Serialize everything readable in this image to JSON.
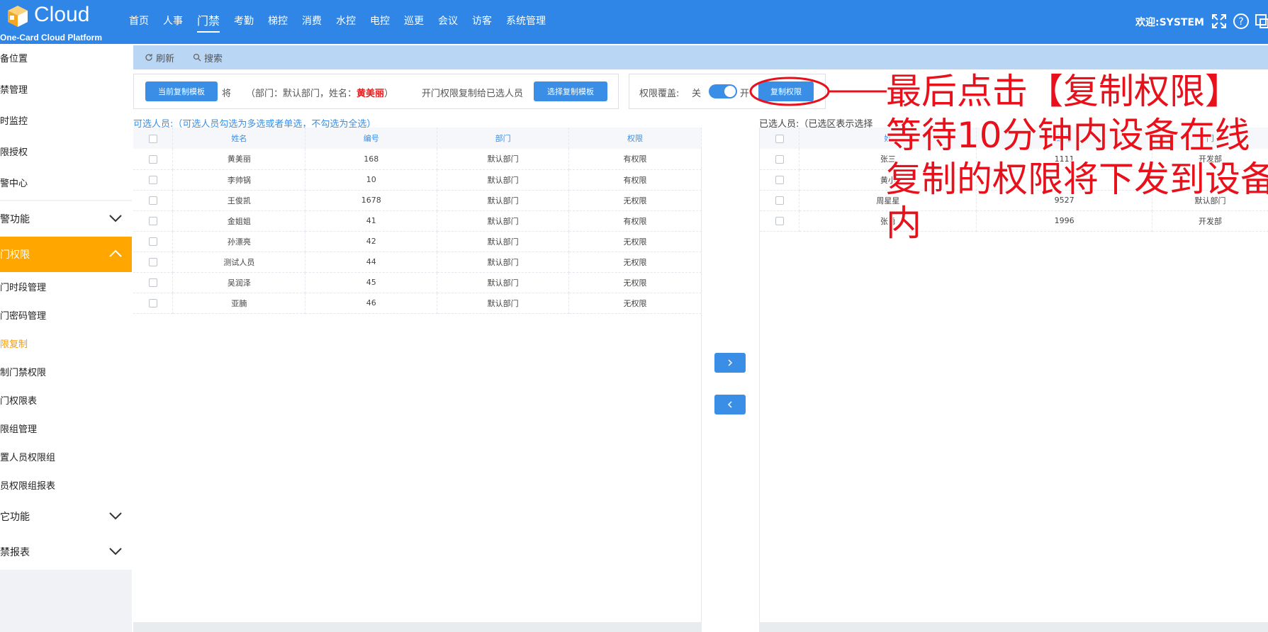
{
  "app": {
    "logo_text": "Cloud",
    "logo_sub": "One-Card Cloud Platform",
    "welcome": "欢迎:SYSTEM"
  },
  "nav": [
    "首页",
    "人事",
    "门禁",
    "考勤",
    "梯控",
    "消费",
    "水控",
    "电控",
    "巡更",
    "会议",
    "访客",
    "系统管理"
  ],
  "sidebar": {
    "top_items": [
      "备位置",
      "禁管理",
      "时监控",
      "限授权",
      "警中心"
    ],
    "group1": "警功能",
    "group_open": "门权限",
    "sub_items": [
      "门时段管理",
      "门密码管理",
      "限复制",
      "制门禁权限",
      "门权限表",
      "限组管理",
      "置人员权限组",
      "员权限组报表"
    ],
    "group3": "它功能",
    "group4": "禁报表"
  },
  "toolbar": {
    "refresh": "刷新",
    "search": "搜索"
  },
  "copy_cfg": {
    "current_tpl_btn": "当前复制模板",
    "will": "将",
    "desc_prefix": "（部门：默认部门，姓名：",
    "name": "黄美丽",
    "desc_suffix": "）",
    "copy_to": "开门权限复制给已选人员",
    "choose_tpl_btn": "选择复制模板",
    "overwrite_label": "权限覆盖:",
    "off": "关",
    "on": "开",
    "copy_btn": "复制权限"
  },
  "left_table": {
    "hint": "可选人员:（可选人员勾选为多选或者单选，不勾选为全选）",
    "headers": [
      "姓名",
      "编号",
      "部门",
      "权限"
    ],
    "rows": [
      {
        "name": "黄美丽",
        "id": "168",
        "dept": "默认部门",
        "perm": "有权限"
      },
      {
        "name": "李帅锅",
        "id": "10",
        "dept": "默认部门",
        "perm": "有权限"
      },
      {
        "name": "王俊凯",
        "id": "1678",
        "dept": "默认部门",
        "perm": "无权限"
      },
      {
        "name": "金姐姐",
        "id": "41",
        "dept": "默认部门",
        "perm": "有权限"
      },
      {
        "name": "孙漂亮",
        "id": "42",
        "dept": "默认部门",
        "perm": "无权限"
      },
      {
        "name": "测试人员",
        "id": "44",
        "dept": "默认部门",
        "perm": "无权限"
      },
      {
        "name": "吴润泽",
        "id": "45",
        "dept": "默认部门",
        "perm": "无权限"
      },
      {
        "name": "亚腩",
        "id": "46",
        "dept": "默认部门",
        "perm": "无权限"
      }
    ]
  },
  "right_table": {
    "hint": "已选人员:（已选区表示选择",
    "headers": [
      "姓",
      "编号",
      "门"
    ],
    "rows": [
      {
        "name": "张三",
        "id": "1111",
        "dept": "开发部"
      },
      {
        "name": "黄小",
        "id": "",
        "dept": ""
      },
      {
        "name": "周星星",
        "id": "9527",
        "dept": "默认部门"
      },
      {
        "name": "张勇",
        "id": "1996",
        "dept": "开发部"
      }
    ]
  },
  "annotation": {
    "line1": "最后点击【复制权限】",
    "line2": "等待10分钟内设备在线",
    "line3": "复制的权限将下发到设备",
    "line4": "内"
  },
  "colors": {
    "topbar": "#2f86e6",
    "accent": "#3a8ee6",
    "sidebar_active": "#ffa600",
    "annotation": "#e8111b"
  }
}
